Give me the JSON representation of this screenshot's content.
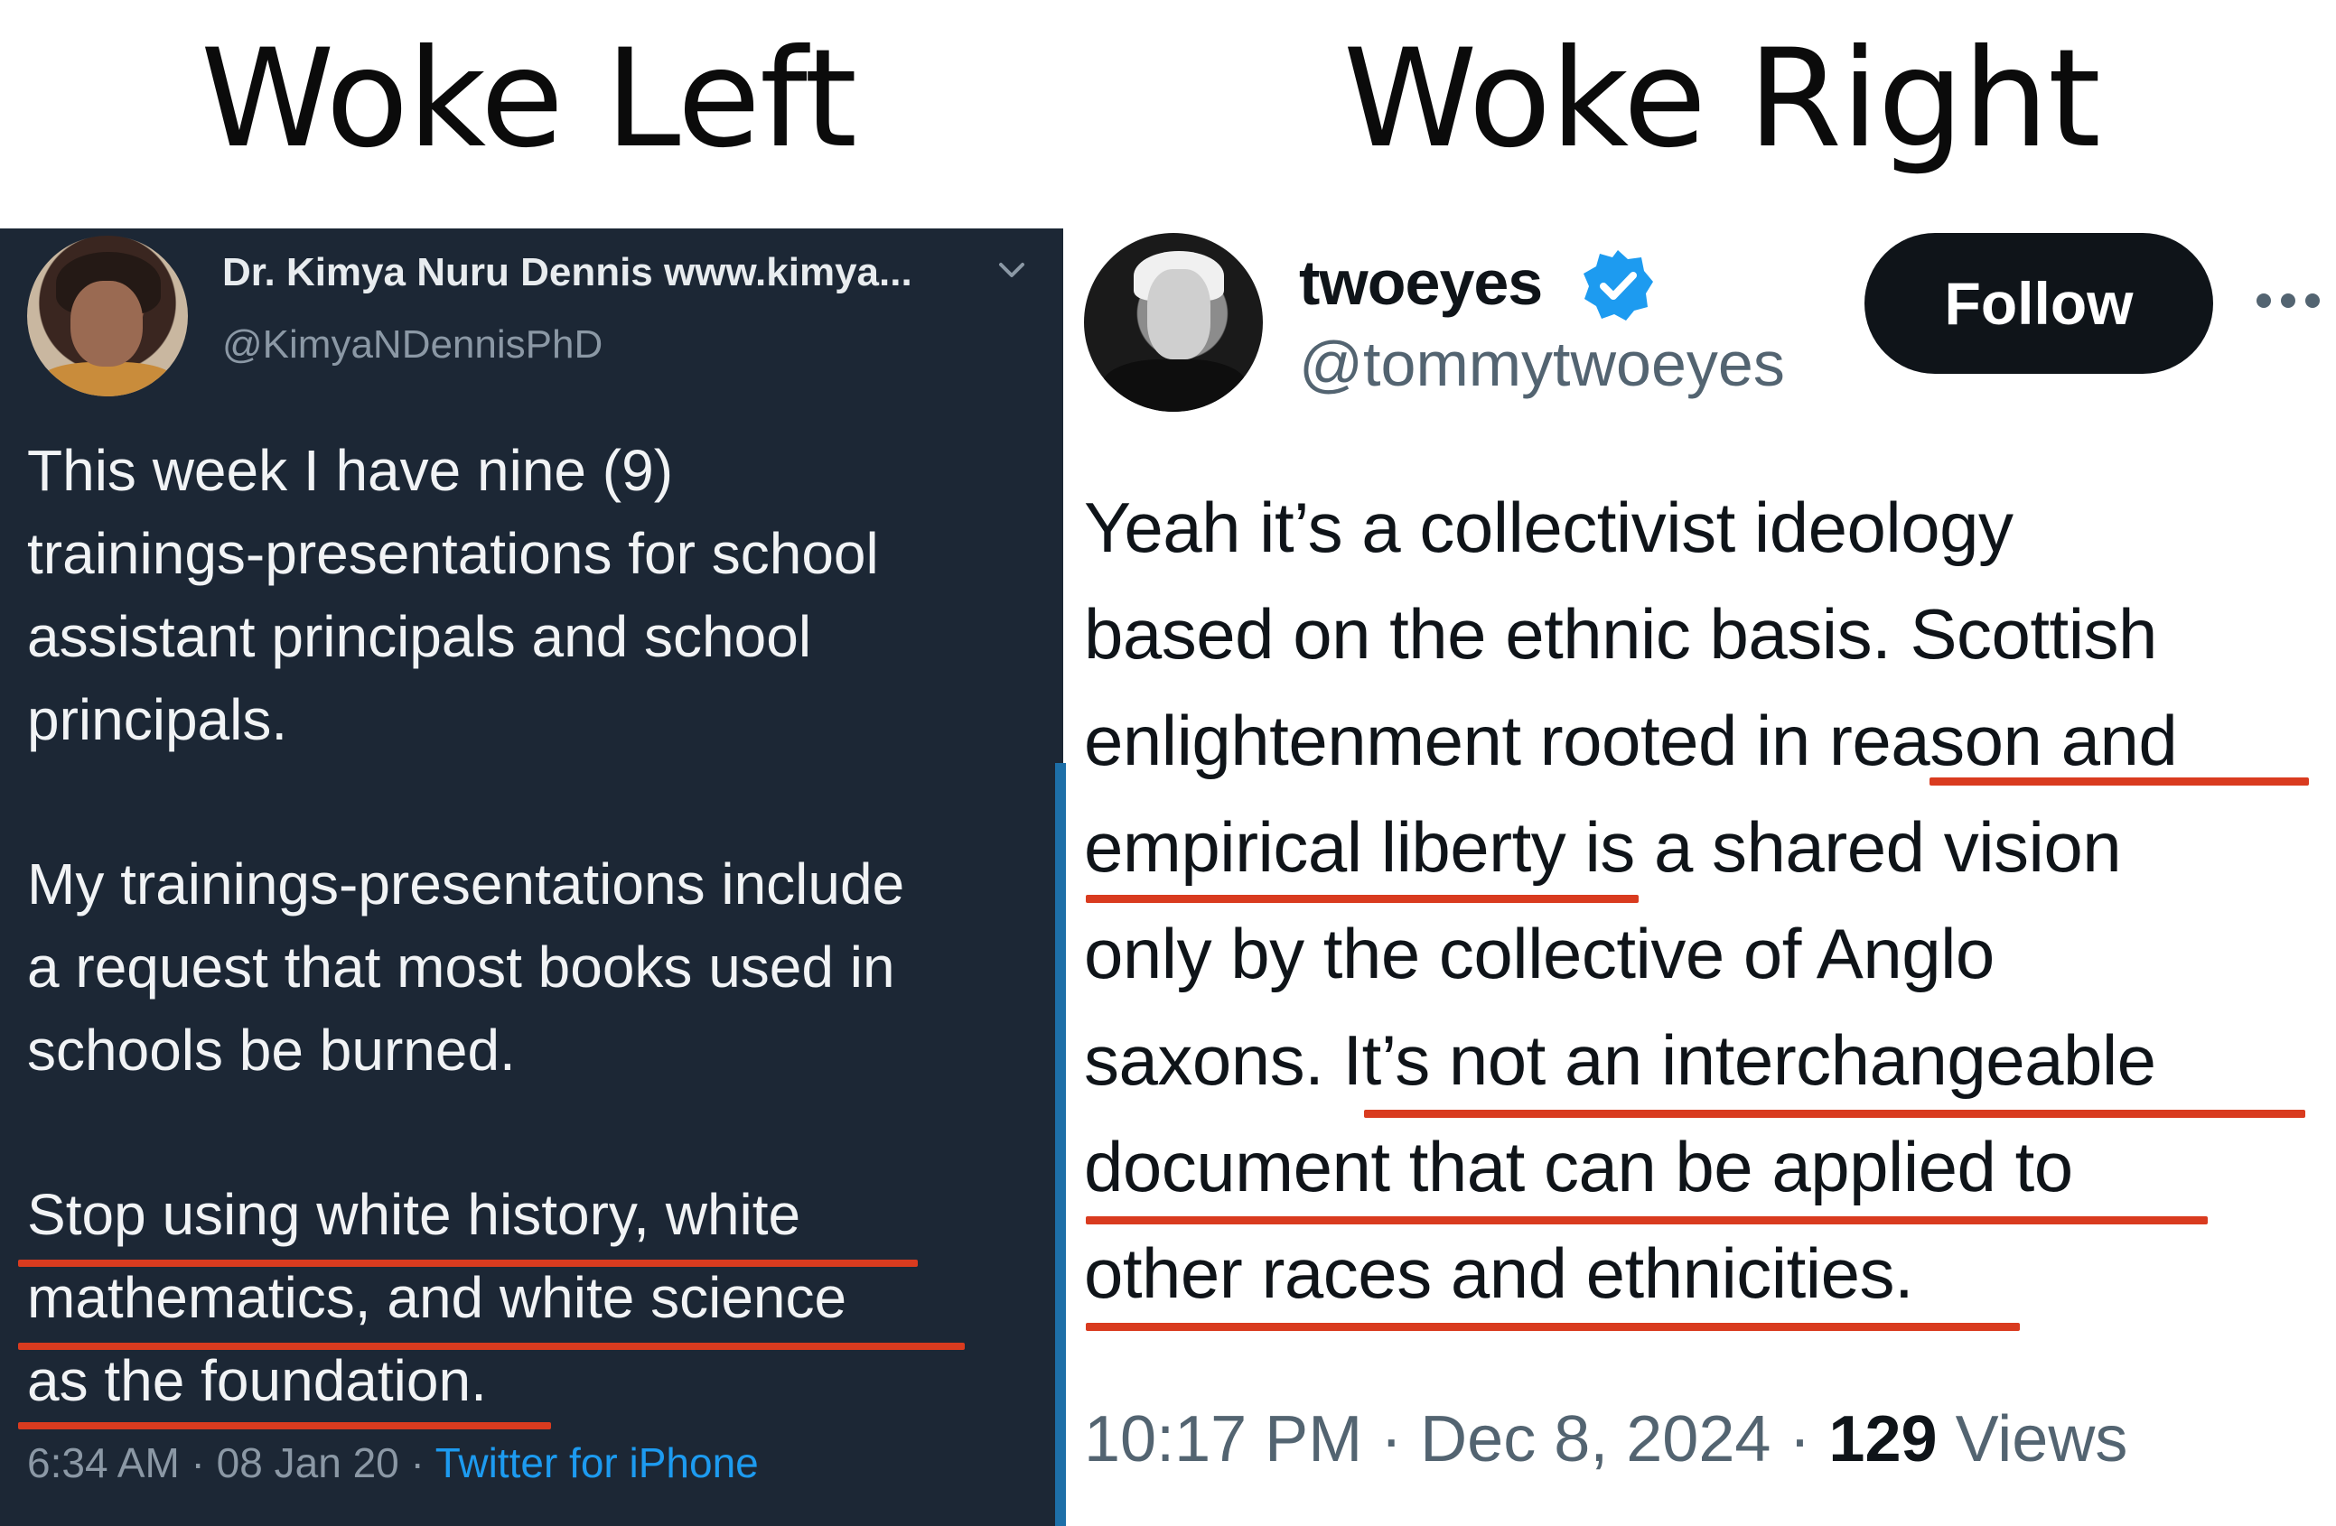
{
  "headings": {
    "left": "Woke Left",
    "right": "Woke Right"
  },
  "left_tweet": {
    "display_name": "Dr. Kimya Nuru Dennis www.kimya...",
    "handle": "@KimyaNDennisPhD",
    "lines": [
      "This week I have nine (9)",
      "trainings-presentations for school",
      "assistant principals and school",
      "principals.",
      "My trainings-presentations include",
      "a request that most books used in",
      "schools be burned.",
      "Stop using white history, white",
      "mathematics, and white science",
      "as the foundation."
    ],
    "time": "6:34 AM",
    "separator": " · ",
    "date": "08 Jan 20",
    "source": "Twitter for iPhone",
    "icons": {
      "menu": "chevron-down-icon",
      "avatar": "profile-photo"
    }
  },
  "right_tweet": {
    "display_name": "twoeyes",
    "handle": "@tommytwoeyes",
    "follow_label": "Follow",
    "lines": [
      "Yeah it’s a collectivist ideology",
      "based on the ethnic basis. Scottish",
      "enlightenment rooted in reason and",
      "empirical liberty is a shared vision",
      "only by the collective of Anglo",
      "saxons. It’s not an interchangeable",
      "document that can be applied to",
      "other races and ethnicities."
    ],
    "time": "10:17 PM",
    "separator": " · ",
    "date": "Dec 8, 2024",
    "views_count": "129",
    "views_label": " Views",
    "icons": {
      "verified": "verified-badge-icon",
      "more": "more-dots-icon"
    },
    "colors": {
      "verified": "#1d9bf0",
      "underline": "#d93b1f"
    }
  }
}
